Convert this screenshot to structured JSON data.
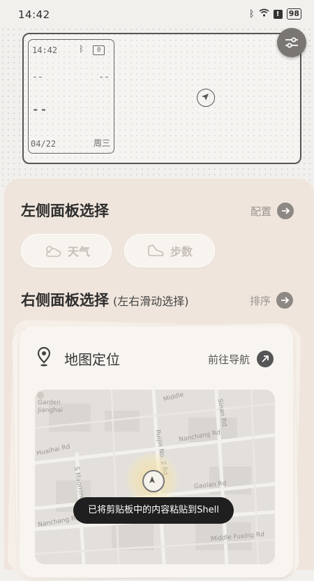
{
  "status_bar": {
    "time": "14:42",
    "battery": "98"
  },
  "device_preview": {
    "time": "14:42",
    "battery": "0",
    "dash_left": "--",
    "dash_right": "--",
    "big_dash": "--",
    "date": "04/22",
    "weekday": "周三"
  },
  "left_panel": {
    "title": "左侧面板选择",
    "action_label": "配置",
    "chips": [
      {
        "label": "天气",
        "icon": "weather-icon"
      },
      {
        "label": "步数",
        "icon": "shoe-icon"
      }
    ]
  },
  "right_panel": {
    "title": "右侧面板选择",
    "subtitle": "(左右滑动选择)",
    "action_label": "排序"
  },
  "map_card": {
    "title": "地图定位",
    "action_label": "前往导航",
    "map_labels": {
      "garden": "Garden",
      "garden2": "Jianghai",
      "middle": "Middle",
      "sinan": "Sinan Rd",
      "ruijin": "Ruijin No. 2 Rd",
      "nanchang": "Nanchang Rd",
      "huaihai": "Huaihai Rd",
      "maoming": "S Maoming",
      "gaolan": "Gaolan Rd",
      "nanchang2": "Nanchang Rd",
      "fuxing": "Middle Fuxing Rd"
    }
  },
  "toast": "已将剪贴板中的内容粘贴到Shell"
}
